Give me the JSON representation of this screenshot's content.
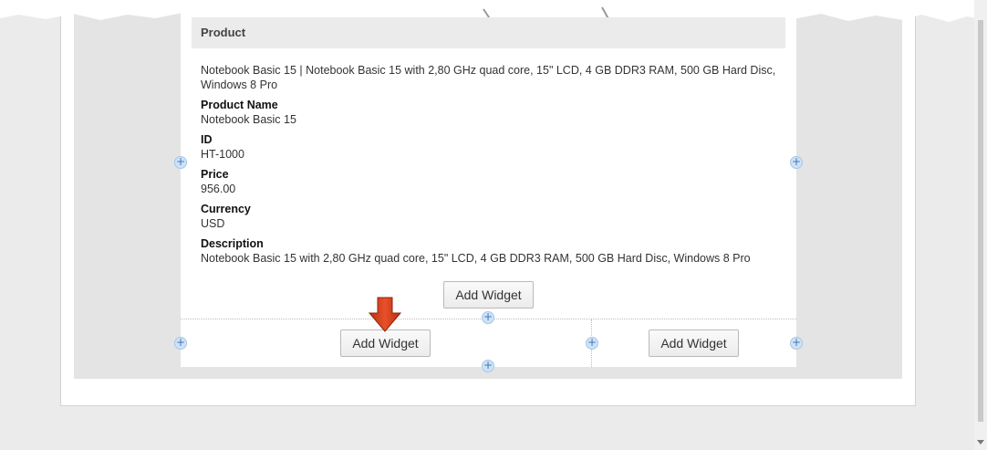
{
  "product_widget": {
    "header": "Product",
    "summary": "Notebook Basic 15 | Notebook Basic 15 with 2,80 GHz quad core, 15\" LCD, 4 GB DDR3 RAM, 500 GB Hard Disc, Windows 8 Pro",
    "fields": [
      {
        "label": "Product Name",
        "value": "Notebook Basic 15"
      },
      {
        "label": "ID",
        "value": "HT-1000"
      },
      {
        "label": "Price",
        "value": "956.00"
      },
      {
        "label": "Currency",
        "value": "USD"
      },
      {
        "label": "Description",
        "value": "Notebook Basic 15 with 2,80 GHz quad core, 15\" LCD, 4 GB DDR3 RAM, 500 GB Hard Disc, Windows 8 Pro"
      }
    ]
  },
  "buttons": {
    "add_widget_top": "Add Widget",
    "add_widget_left": "Add Widget",
    "add_widget_right": "Add Widget"
  },
  "icons": {
    "plus": "+"
  },
  "colors": {
    "accent_arrow": "#d9401d",
    "plus_fill": "#cfe2f5"
  }
}
